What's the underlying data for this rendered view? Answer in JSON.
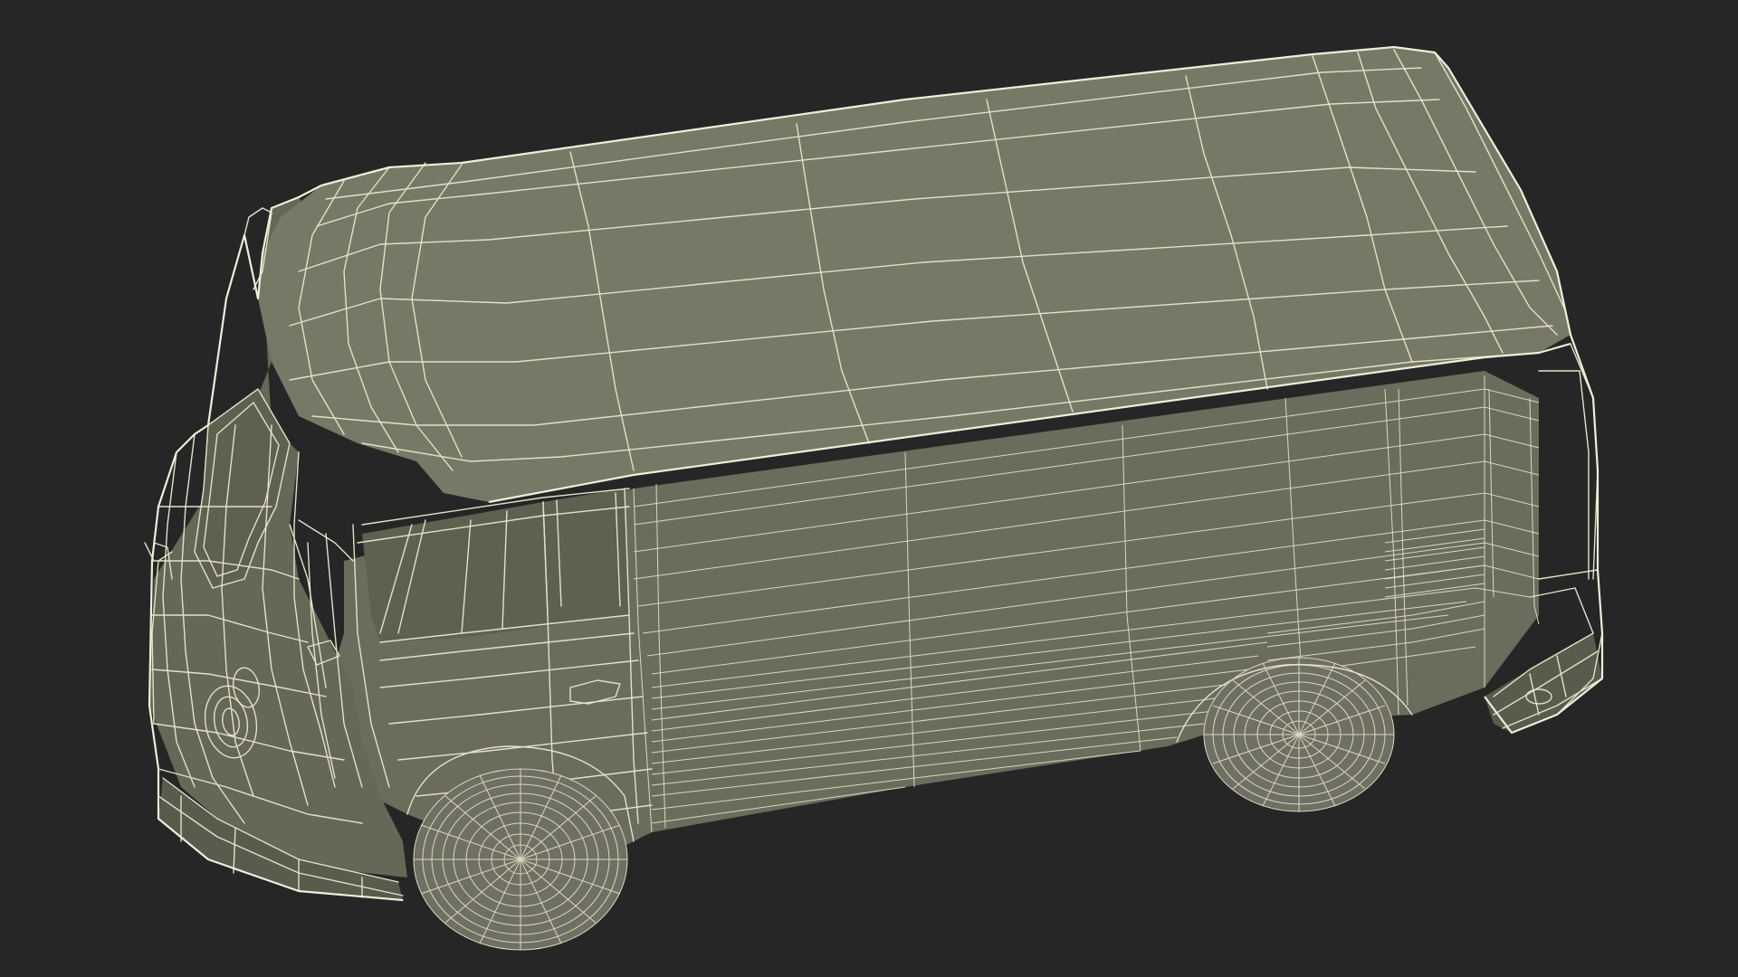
{
  "scene": {
    "subject_icon": "van-wireframe-icon",
    "colors": {
      "background": "#262626",
      "surface": "#777866",
      "wire": "#e2e2c8"
    }
  }
}
